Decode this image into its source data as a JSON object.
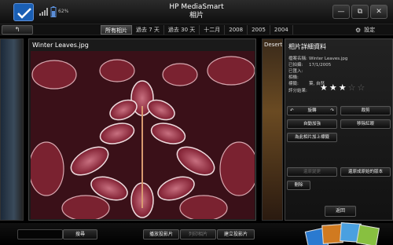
{
  "app": {
    "title": "HP MediaSmart",
    "subtitle": "相片",
    "battery": "62%"
  },
  "window": {
    "minimize": "—",
    "restore": "⧉",
    "close": "✕"
  },
  "nav": {
    "back": "↰",
    "tabs": [
      "所有相片",
      "過去 7 天",
      "過去 30 天",
      "十二月",
      "2008",
      "2005",
      "2004"
    ],
    "active_tab": 0,
    "settings_icon": "⚙",
    "settings_label": "設定"
  },
  "photo": {
    "title": "Winter Leaves.jpg",
    "next_title": "Desert"
  },
  "details": {
    "title": "相片詳細資料",
    "rows": [
      {
        "k": "檔案名稱:",
        "v": "Winter Leaves.jpg"
      },
      {
        "k": "已拍攝:",
        "v": "17/1/2005"
      },
      {
        "k": "已匯入:",
        "v": ""
      },
      {
        "k": "相機:",
        "v": ""
      },
      {
        "k": "標籤:",
        "v": "葉, 自然"
      },
      {
        "k": "評分結果:",
        "v": ""
      }
    ],
    "rating": 3,
    "rating_max": 5,
    "buttons": {
      "rotate_left": "↶",
      "rotate": "旋轉",
      "rotate_right": "↷",
      "crop": "裁剪",
      "auto_fix": "自動加強",
      "redeye": "移除紅眼",
      "add_tag": "為此相片加上標籤",
      "undo": "還原變更",
      "restore_original": "還原成原始的版本",
      "delete": "刪除",
      "back": "返回"
    }
  },
  "bottom": {
    "search_placeholder": "",
    "search_button": "搜尋",
    "slideshow": "播放投影片",
    "print": "列印相片",
    "create_slideshow": "建立投影片"
  }
}
